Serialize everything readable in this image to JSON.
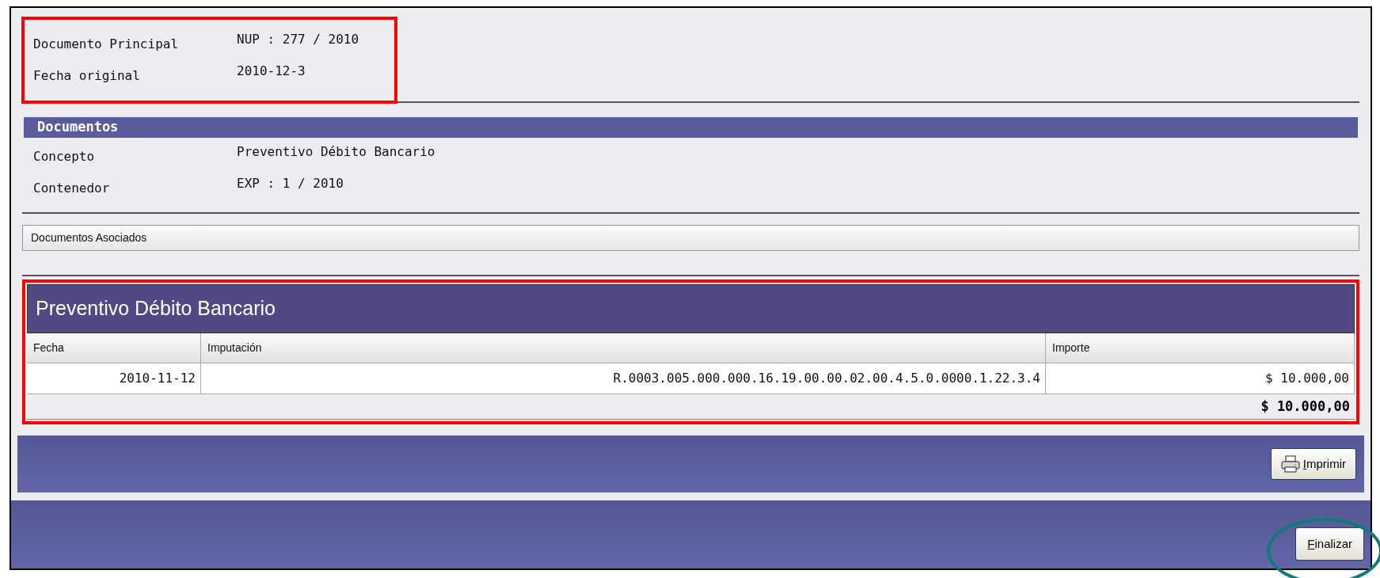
{
  "header_fields": [
    {
      "label": "Documento Principal",
      "value": "NUP : 277 / 2010"
    },
    {
      "label": "Fecha original",
      "value": "2010-12-3"
    }
  ],
  "documentos": {
    "title": "Documentos",
    "fields": [
      {
        "label": "Concepto",
        "value": "Preventivo Débito Bancario"
      },
      {
        "label": "Contenedor",
        "value": "EXP : 1 / 2010"
      }
    ]
  },
  "asociados": {
    "label": "Documentos Asociados"
  },
  "table": {
    "title": "Preventivo Débito Bancario",
    "columns": [
      "Fecha",
      "Imputación",
      "Importe"
    ],
    "rows": [
      [
        "2010-11-12",
        "R.0003.005.000.000.16.19.00.00.02.00.4.5.0.0000.1.22.3.4",
        "$ 10.000,00"
      ]
    ],
    "total": "$ 10.000,00"
  },
  "toolbar": {
    "buttons": [
      {
        "label": "Imprimir"
      }
    ]
  },
  "footer": {
    "buttons": [
      {
        "label": "Finalizar"
      }
    ]
  }
}
